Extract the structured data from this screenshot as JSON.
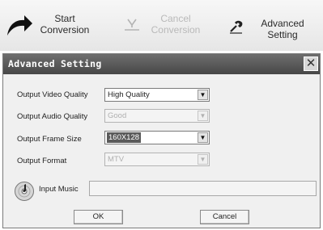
{
  "toolbar": {
    "start": {
      "line1": "Start",
      "line2": "Conversion",
      "icon": "curved-arrow-icon"
    },
    "cancel": {
      "line1": "Cancel",
      "line2": "Conversion",
      "icon": "cancel-icon"
    },
    "advanced": {
      "line1": "Advanced",
      "line2": "Setting",
      "icon": "settings-icon"
    }
  },
  "dialog": {
    "title": "Advanced Setting",
    "close_glyph": "✕",
    "video_quality": {
      "label": "Output Video Quality",
      "value": "High Quality",
      "enabled": true
    },
    "audio_quality": {
      "label": "Output Audio Quality",
      "value": "Good",
      "enabled": false
    },
    "frame_size": {
      "label": "Output Frame Size",
      "value": "160X128",
      "enabled": true
    },
    "format": {
      "label": "Output Format",
      "value": "MTV",
      "enabled": false
    },
    "input_music": {
      "label": "Input Music",
      "value": "",
      "icon": "music-disc-icon"
    },
    "ok_label": "OK",
    "cancel_label": "Cancel"
  }
}
